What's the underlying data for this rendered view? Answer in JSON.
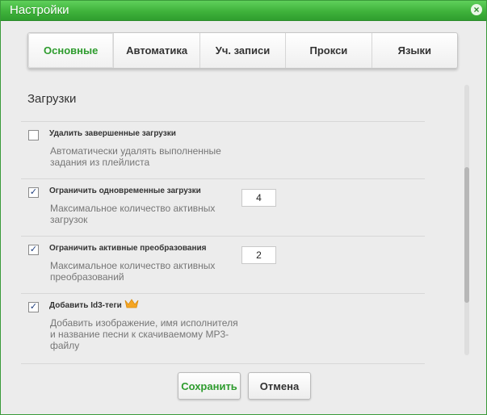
{
  "window": {
    "title": "Настройки",
    "close_glyph": "×"
  },
  "tabs": [
    {
      "label": "Основные",
      "active": true
    },
    {
      "label": "Автоматика",
      "active": false
    },
    {
      "label": "Уч. записи",
      "active": false
    },
    {
      "label": "Прокси",
      "active": false
    },
    {
      "label": "Языки",
      "active": false
    }
  ],
  "section": {
    "title": "Загрузки"
  },
  "settings": [
    {
      "label": "Удалить завершенные загрузки",
      "checked": false,
      "check_glyph": "",
      "description": "Автоматически удалять выполненные\nзадания из плейлиста"
    },
    {
      "label": "Ограничить одновременные загрузки",
      "checked": true,
      "check_glyph": "✓",
      "value": "4",
      "description": "Максимальное количество активных\nзагрузок"
    },
    {
      "label": "Ограничить активные преобразования",
      "checked": true,
      "check_glyph": "✓",
      "value": "2",
      "description": "Максимальное количество активных\nпреобразований"
    },
    {
      "label": "Добавить Id3-теги",
      "checked": true,
      "check_glyph": "✓",
      "icon": "crown-icon",
      "description": "Добавить изображение, имя исполнителя\nи название песни к скачиваемому MP3-\nфайлу"
    }
  ],
  "buttons": {
    "save": "Сохранить",
    "cancel": "Отмена"
  },
  "colors": {
    "accent": "#2e9c2e",
    "titlebar": "#3fb23b",
    "crown": "#f5a623"
  }
}
